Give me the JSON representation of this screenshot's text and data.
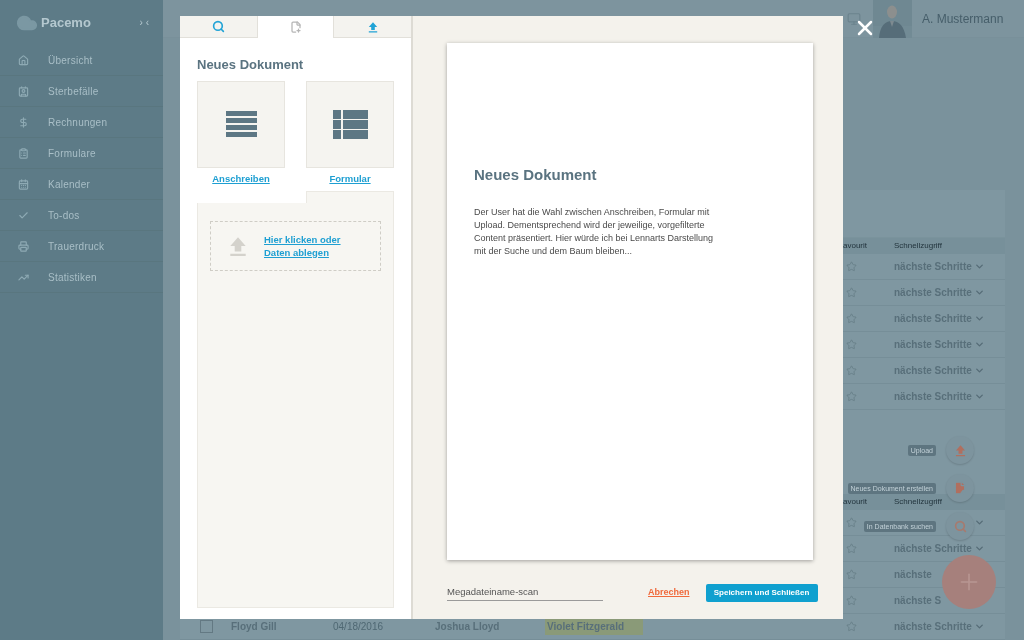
{
  "sidebar": {
    "logo": "Pacemo",
    "collapse_toggle": "› ‹",
    "items": [
      {
        "label": "Übersicht"
      },
      {
        "label": "Sterbefälle"
      },
      {
        "label": "Rechnungen"
      },
      {
        "label": "Formulare"
      },
      {
        "label": "Kalender"
      },
      {
        "label": "To-dos"
      },
      {
        "label": "Trauerdruck"
      },
      {
        "label": "Statistiken"
      }
    ]
  },
  "header": {
    "user_name": "A. Mustermann"
  },
  "table": {
    "sections": [
      {
        "columns": [
          "avourit",
          "Schnellzugriff"
        ],
        "rows": [
          {
            "quick_access": "nächste Schritte"
          },
          {
            "quick_access": "nächste Schritte"
          },
          {
            "quick_access": "nächste Schritte"
          },
          {
            "quick_access": "nächste Schritte"
          },
          {
            "quick_access": "nächste Schritte"
          },
          {
            "quick_access": "nächste Schritte"
          }
        ]
      },
      {
        "columns": [
          "avourit",
          "Schnellzugriff"
        ],
        "rows": [
          {},
          {
            "quick_access": "nächste Schritte"
          },
          {
            "quick_access": "nächste"
          },
          {
            "quick_access": "nächste S"
          },
          {
            "name": "Floyd Gill",
            "checked": false,
            "date": "04/18/2016",
            "contact": "Joshua Lloyd",
            "deceased": "Violet Fitzgerald",
            "highlighted": true,
            "quick_access": "nächste Schritte"
          }
        ]
      }
    ]
  },
  "fab_menu": {
    "actions": [
      {
        "tooltip": "Upload"
      },
      {
        "tooltip": "Neues Dokument erstellen"
      },
      {
        "tooltip": "In Datenbank suchen"
      }
    ]
  },
  "modal": {
    "tabs": [
      {
        "selected": false
      },
      {
        "selected": true
      },
      {
        "selected": false
      }
    ],
    "title": "Neues Dokument",
    "templates": [
      {
        "label": "Anschreiben"
      },
      {
        "label": "Formular"
      }
    ],
    "dropzone": {
      "link": "Hier klicken oder Daten ablegen"
    },
    "preview": {
      "title": "Neues Dokument",
      "body": "Der User hat die Wahl zwischen Anschreiben, Formular mit Upload. Dementsprechend wird der jeweilige, vorgefilterte Content präsentiert. Hier würde ich bei Lennarts Darstellung mit der Suche und dem Baum bleiben..."
    },
    "filename": "Megadateiname-scan",
    "cancel": "Abrechen",
    "save": "Speichern und Schließen"
  }
}
